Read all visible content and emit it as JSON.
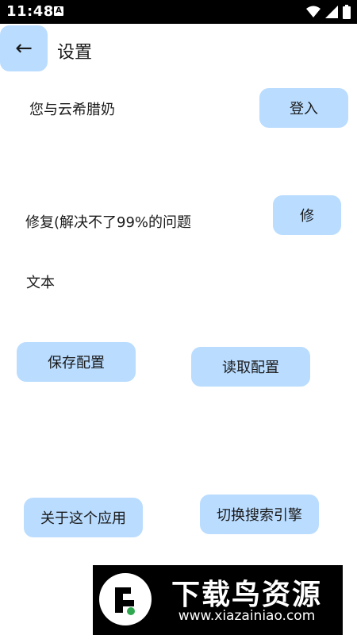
{
  "status_bar": {
    "time": "11:48",
    "notification_badge": "A"
  },
  "header": {
    "title": "设置",
    "back_icon": "←"
  },
  "settings": {
    "account_text": "您与云希腊奶",
    "login_button": "登入",
    "repair_text": "修复(解决不了99%的问题",
    "repair_button": "修",
    "plain_text": "文本",
    "save_config_button": "保存配置",
    "load_config_button": "读取配置",
    "about_button": "关于这个应用",
    "switch_engine_button": "切换搜索引擎"
  },
  "watermark": {
    "title": "下载鸟资源",
    "url": "www.xiazainiao.com"
  },
  "colors": {
    "button_bg": "#b9dcff",
    "statusbar_bg": "#000000"
  }
}
